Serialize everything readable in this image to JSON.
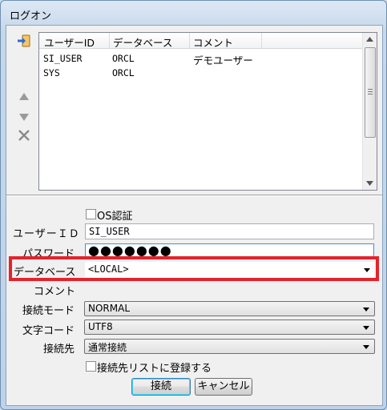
{
  "window": {
    "title": "ログオン"
  },
  "connection_list": {
    "columns": [
      "ユーザーID",
      "データベース",
      "コメント"
    ],
    "rows": [
      {
        "user": "SI_USER",
        "database": "ORCL",
        "comment": "デモユーザー"
      },
      {
        "user": "SYS",
        "database": "ORCL",
        "comment": ""
      }
    ]
  },
  "form": {
    "os_auth_label": "OS認証",
    "user_id_label": "ユーザーＩＤ",
    "user_id_value": "SI_USER",
    "password_label": "パスワード",
    "password_value": "●●●●●●●",
    "database_label": "データベース",
    "database_value": "<LOCAL>",
    "comment_label": "コメント",
    "comment_value": "",
    "connect_mode_label": "接続モード",
    "connect_mode_value": "NORMAL",
    "charset_label": "文字コード",
    "charset_value": "UTF8",
    "destination_label": "接続先",
    "destination_value": "通常接続",
    "register_label": "接続先リストに登録する"
  },
  "buttons": {
    "connect": "接続",
    "cancel": "キャンセル"
  },
  "colors": {
    "highlight": "#e3232c"
  }
}
